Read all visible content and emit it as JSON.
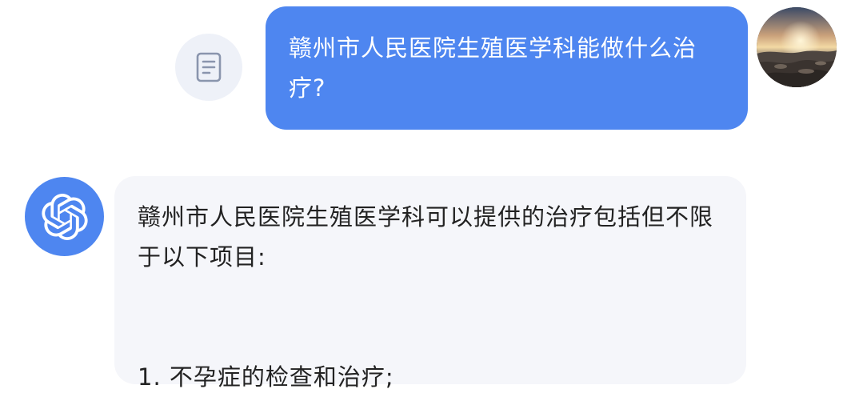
{
  "messages": {
    "user": {
      "text": "赣州市人民医院生殖医学科能做什么治疗?"
    },
    "bot": {
      "intro": "赣州市人民医院生殖医学科可以提供的治疗包括但不限于以下项目:",
      "items": [
        "1. 不孕症的检查和治疗;"
      ]
    }
  },
  "colors": {
    "user_bubble": "#4e86f0",
    "bot_bubble": "#f5f6fa",
    "bot_avatar": "#4e86f0",
    "copy_button": "#eef1f8"
  },
  "icons": {
    "copy": "document-copy-icon",
    "bot": "openai-logo-icon",
    "user": "landscape-avatar"
  }
}
